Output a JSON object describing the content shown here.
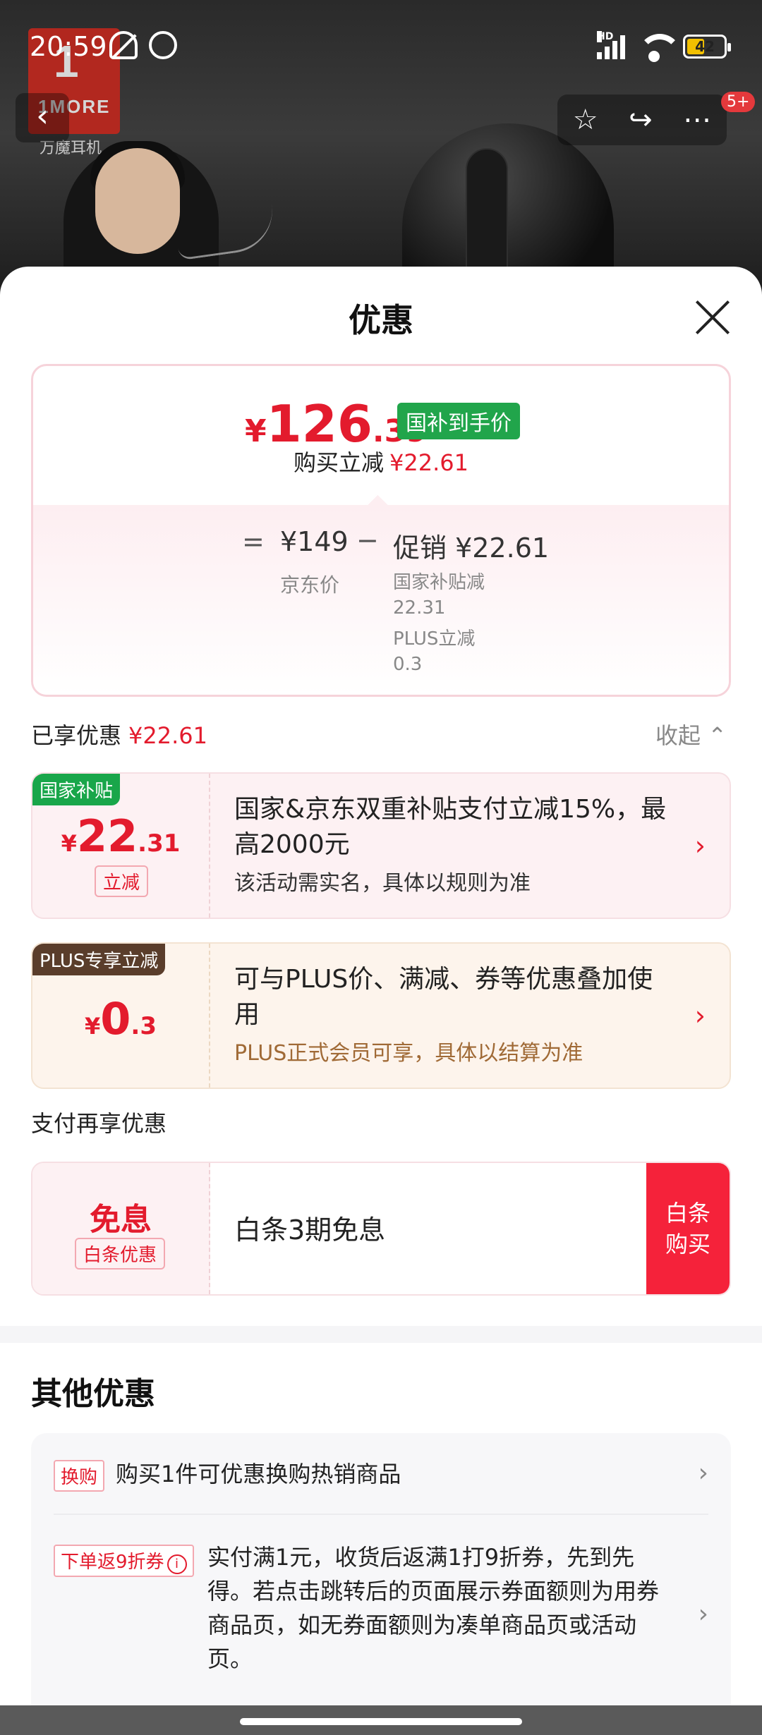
{
  "status_bar": {
    "time": "20:59",
    "network_label": "HD",
    "battery_level": "42",
    "battery_fraction": 0.42
  },
  "backdrop": {
    "brand_logo_text": "1MORE",
    "brand_sub": "万魔耳机"
  },
  "nav": {
    "badge": "5+"
  },
  "sheet": {
    "title": "优惠"
  },
  "price_card": {
    "currency": "¥",
    "final_int": "126",
    "final_dec": ".39",
    "subsidy_tag": "国补到手价",
    "reduce_label": "购买立减",
    "reduce_amount": "¥22.61",
    "equals": "=",
    "jd_price": "¥149",
    "jd_price_label": "京东价",
    "minus": "−",
    "promo_label": "促销 ¥22.61",
    "breakdown": [
      {
        "label": "国家补贴减",
        "value": "22.31"
      },
      {
        "label": "PLUS立减",
        "value": "0.3"
      }
    ]
  },
  "enjoyed": {
    "label": "已享优惠",
    "amount": "¥22.61",
    "collapse": "收起"
  },
  "gov_card": {
    "tag": "国家补贴",
    "currency": "¥",
    "amount_int": "22",
    "amount_dec": ".31",
    "sub_tag": "立减",
    "headline": "国家&京东双重补贴支付立减15%，最高2000元",
    "detail": "该活动需实名，具体以规则为准"
  },
  "plus_card": {
    "tag": "PLUS专享立减",
    "currency": "¥",
    "amount_int": "0",
    "amount_dec": ".3",
    "headline": "可与PLUS价、满减、券等优惠叠加使用",
    "detail": "PLUS正式会员可享，具体以结算为准"
  },
  "pay_section": {
    "title": "支付再享优惠",
    "main": "免息",
    "sub_tag": "白条优惠",
    "text": "白条3期免息",
    "buy_button": "白条购买"
  },
  "other": {
    "title": "其他优惠",
    "rows": [
      {
        "tag": "换购",
        "text": "购买1件可优惠换购热销商品"
      },
      {
        "tag": "下单返9折券",
        "text": "实付满1元，收货后返满1打9折券，先到先得。若点击跳转后的页面展示券面额则为用券商品页，如无券面额则为凑单商品页或活动页。"
      }
    ]
  },
  "colors": {
    "accent_red": "#e31b2d",
    "subsidy_green": "#21a54b",
    "plus_brown": "#5a3d2b",
    "buy_red": "#f5223a"
  }
}
